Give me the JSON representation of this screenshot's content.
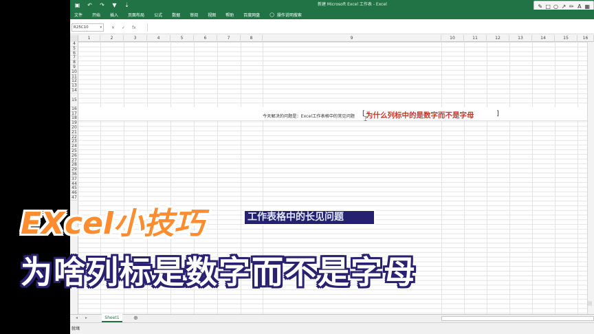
{
  "app": {
    "window_title": "新建 Microsoft Excel 工作表 - Excel",
    "accent_color": "#217346"
  },
  "quick_access": [
    {
      "icon": "save-icon",
      "glyph": "▣"
    },
    {
      "icon": "undo-icon",
      "glyph": "↶"
    },
    {
      "icon": "redo-icon",
      "glyph": "↷"
    },
    {
      "icon": "filter-icon",
      "glyph": "▼"
    },
    {
      "icon": "customize-icon",
      "glyph": "⇣"
    }
  ],
  "ribbon_tabs": [
    "文件",
    "开始",
    "插入",
    "页面布局",
    "公式",
    "数据",
    "审阅",
    "视图",
    "帮助",
    "百度网盘"
  ],
  "tell_me": {
    "icon": "lightbulb-icon",
    "label": "操作说明搜索"
  },
  "draw_tools": [
    {
      "icon": "pen-icon",
      "glyph": "✎"
    },
    {
      "icon": "rectangle-icon",
      "glyph": "□"
    },
    {
      "icon": "ellipse-icon",
      "glyph": "○"
    },
    {
      "icon": "arrow-icon",
      "glyph": "↗"
    },
    {
      "icon": "pencil-icon",
      "glyph": "✏"
    },
    {
      "icon": "text-icon",
      "glyph": "A"
    },
    {
      "icon": "mosaic-icon",
      "glyph": "▦"
    }
  ],
  "formula_bar": {
    "name_box": "R25C10",
    "cancel": "✕",
    "enter": "✓",
    "fx": "fx",
    "value": ""
  },
  "columns": [
    "1",
    "2",
    "3",
    "4",
    "5",
    "6",
    "7",
    "8",
    "9",
    "10",
    "11",
    "12",
    "13",
    "14",
    "15",
    "16"
  ],
  "rows": [
    "4",
    "5",
    "6",
    "7",
    "8",
    "9",
    "10",
    "11",
    "12",
    "13",
    "14",
    "15",
    "16",
    "17",
    "18",
    "19",
    "20",
    "21",
    "22",
    "23",
    "24",
    "25",
    "26",
    "27",
    "28",
    "29",
    "36",
    "37",
    "44",
    "45",
    "46",
    "47"
  ],
  "cell_content": {
    "text": "今天解决的问题是：Excel工作表格中的常见问题",
    "open_bracket": "[",
    "highlight": "为什么列标中的是数字而不是字母",
    "close_bracket": "]"
  },
  "sheets": [
    {
      "name": "Sheet1",
      "active": true
    }
  ],
  "add_sheet": "⊕",
  "status": {
    "text": "就绪"
  },
  "overlay": {
    "subtitle": "工作表格中的长见问题",
    "title_line1": "EXcel小技巧",
    "title_line2": "为啥列标是数字而不是字母",
    "title1_color": "#ff8c2e",
    "title2_stroke": "#2a2070"
  },
  "watermark": "测"
}
